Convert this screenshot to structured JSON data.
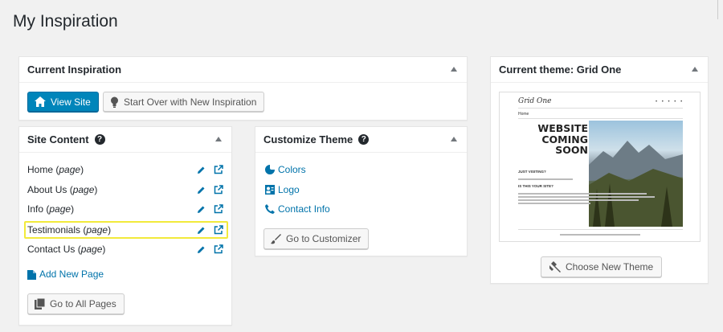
{
  "page": {
    "title": "My Inspiration"
  },
  "current_inspiration": {
    "title": "Current Inspiration",
    "view_site": "View Site",
    "start_over": "Start Over with New Inspiration"
  },
  "site_content": {
    "title": "Site Content",
    "help": "?",
    "items": [
      {
        "name": "Home",
        "type": "page"
      },
      {
        "name": "About Us",
        "type": "page"
      },
      {
        "name": "Info",
        "type": "page"
      },
      {
        "name": "Testimonials",
        "type": "page"
      },
      {
        "name": "Contact Us",
        "type": "page"
      }
    ],
    "add_new_page": "Add New Page",
    "go_to_all_pages": "Go to All Pages"
  },
  "customize_theme": {
    "title": "Customize Theme",
    "help": "?",
    "links": [
      "Colors",
      "Logo",
      "Contact Info"
    ],
    "go_to_customizer": "Go to Customizer"
  },
  "current_theme": {
    "title": "Current theme: Grid One",
    "preview": {
      "logo": "Grid One",
      "menu": "Home",
      "headline": [
        "WEBSITE",
        "COMING",
        "SOON"
      ],
      "subhead1": "JUST VISITING?",
      "subhead2": "IS THIS YOUR SITE?"
    },
    "choose_new_theme": "Choose New Theme"
  },
  "colors": {
    "primary": "#0085ba",
    "link": "#0073aa",
    "highlight": "#f2ea3b",
    "background": "#f1f1f1"
  }
}
